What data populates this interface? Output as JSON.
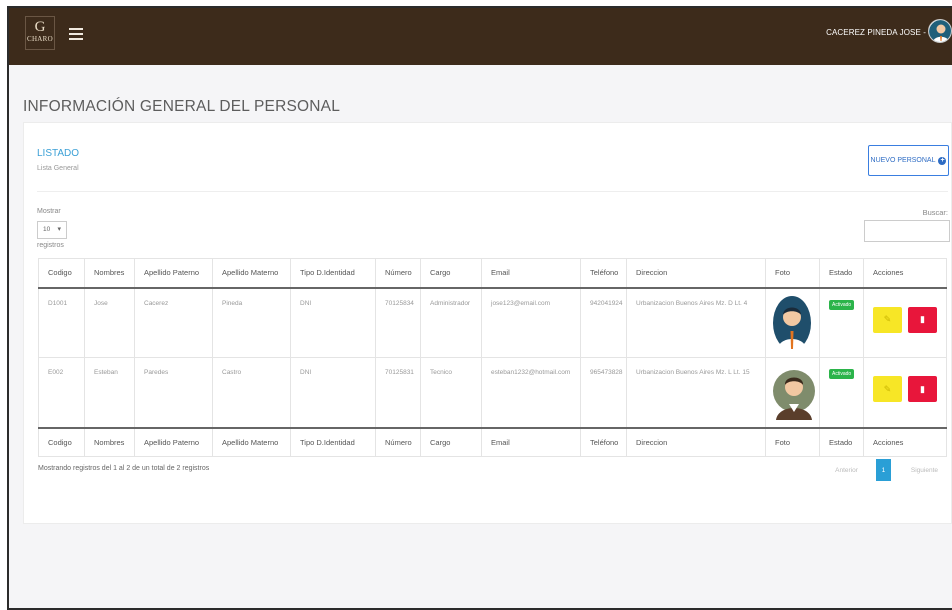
{
  "header": {
    "logo_mono": "G",
    "logo_word": "CHARO",
    "user_name": "CACEREZ PINEDA JOSE -",
    "menu_icon": "hamburger-icon",
    "avatar_icon": "user-avatar-icon",
    "bg_color": "#3d2b1b"
  },
  "page": {
    "title": "INFORMACIÓN GENERAL DEL PERSONAL"
  },
  "card": {
    "title": "LISTADO",
    "subtitle": "Lista General",
    "new_button": "NUEVO PERSONAL",
    "new_icon": "plus-circle-icon"
  },
  "controls": {
    "show_label": "Mostrar",
    "page_length": "10",
    "records_label": "registros",
    "search_label": "Buscar:",
    "search_value": ""
  },
  "table": {
    "columns": [
      "Codigo",
      "Nombres",
      "Apellido Paterno",
      "Apellido Materno",
      "Tipo D.Identidad",
      "Número",
      "Cargo",
      "Email",
      "Teléfono",
      "Direccion",
      "Foto",
      "Estado",
      "Acciones"
    ],
    "rows": [
      {
        "codigo": "D1001",
        "nombres": "Jose",
        "apellido_paterno": "Cacerez",
        "apellido_materno": "Pineda",
        "tipo": "DNI",
        "numero": "70125834",
        "cargo": "Administrador",
        "email": "jose123@email.com",
        "telefono": "942041924",
        "direccion": "Urbanizacion Buenos Aires Mz. D Lt. 4",
        "foto_icon": "male-avatar-icon",
        "estado": "Activado"
      },
      {
        "codigo": "E002",
        "nombres": "Esteban",
        "apellido_paterno": "Paredes",
        "apellido_materno": "Castro",
        "tipo": "DNI",
        "numero": "70125831",
        "cargo": "Tecnico",
        "email": "esteban1232@hotmail.com",
        "telefono": "965473828",
        "direccion": "Urbanizacion Buenos Aires Mz. L Lt. 15",
        "foto_icon": "male-avatar-icon",
        "estado": "Activado"
      }
    ],
    "edit_icon": "edit-icon",
    "delete_icon": "trash-icon"
  },
  "footer": {
    "info": "Mostrando registros del 1 al 2 de un total de 2 registros",
    "prev": "Anterior",
    "page": "1",
    "next": "Siguiente"
  },
  "colors": {
    "accent": "#2a9fd6",
    "badge": "#2bb44a",
    "edit": "#f7e626",
    "delete": "#e8163b"
  }
}
